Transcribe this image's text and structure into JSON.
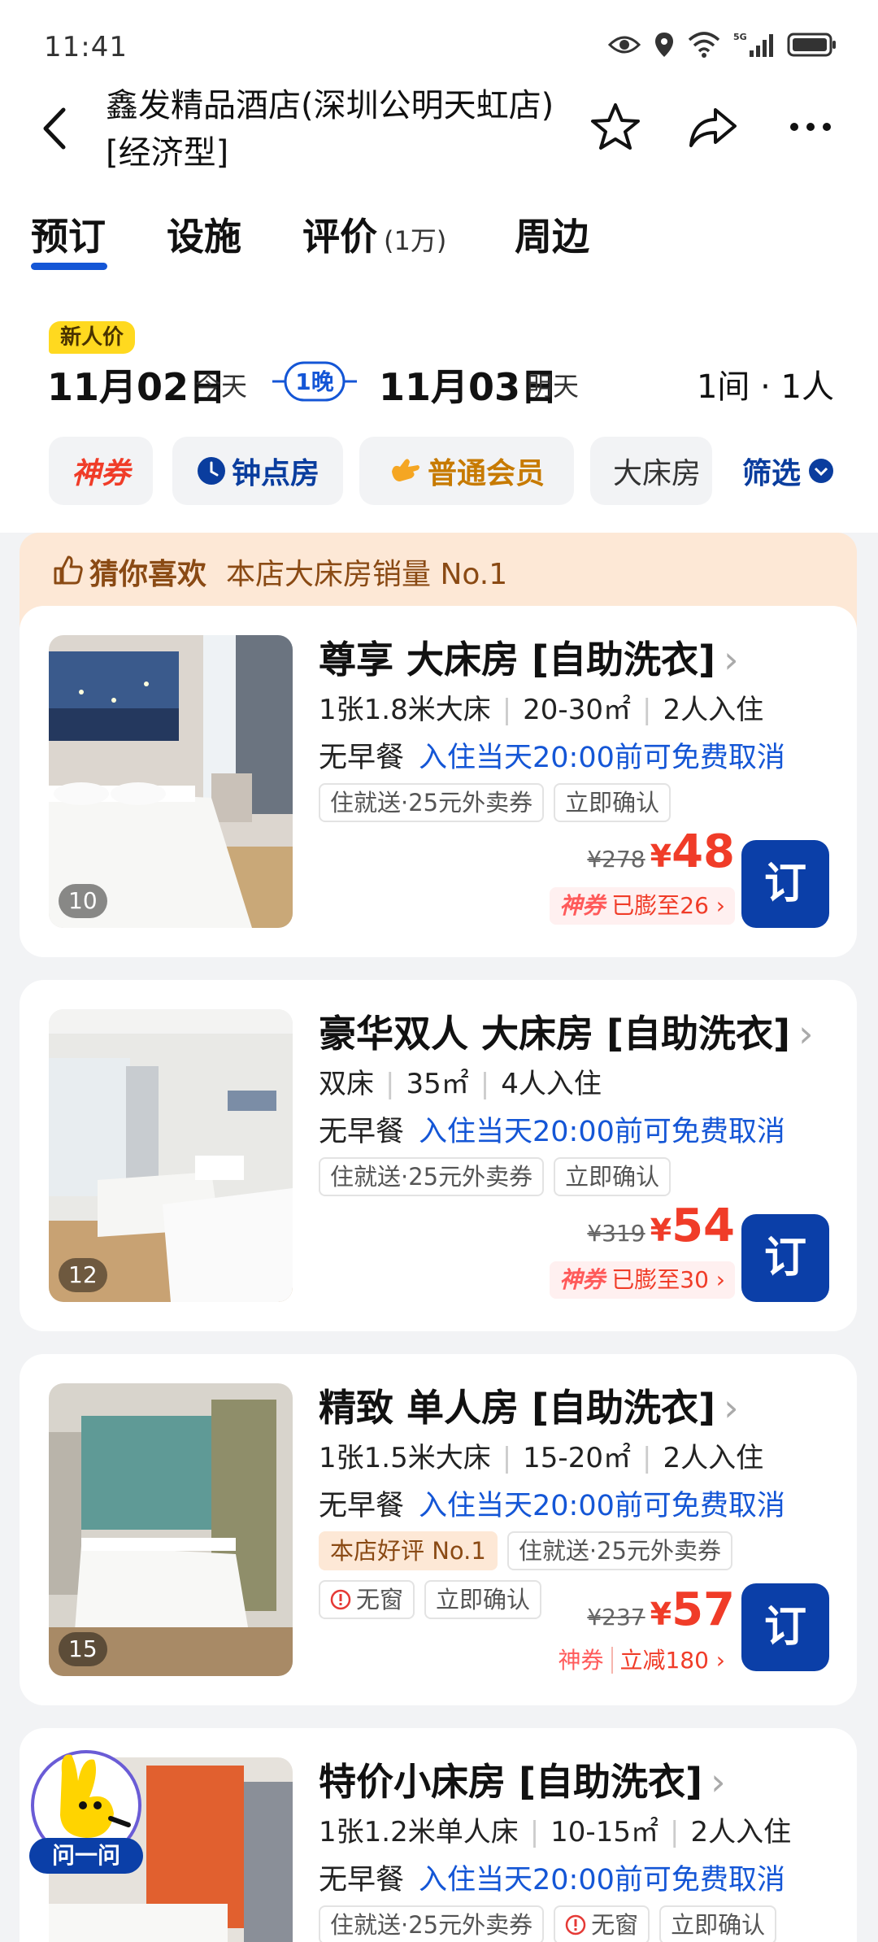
{
  "status": {
    "time": "11:41"
  },
  "header": {
    "title": "鑫发精品酒店(深圳公明天虹店)[经济型]"
  },
  "tabs": [
    {
      "label": "预订"
    },
    {
      "label": "设施"
    },
    {
      "label": "评价",
      "count": "(1万)"
    },
    {
      "label": "周边"
    }
  ],
  "dates": {
    "badge": "新人价",
    "checkin": "11月02日",
    "checkin_sub": "今天",
    "nights": "1晚",
    "checkout": "11月03日",
    "checkout_sub": "明天",
    "rooms": "1间 · 1人"
  },
  "filters": {
    "chips": [
      "神券",
      "钟点房",
      "普通会员",
      "大床房"
    ],
    "filter_label": "筛选"
  },
  "guess": {
    "title": "猜你喜欢",
    "text": "本店大床房销量 No.1"
  },
  "rooms": [
    {
      "name": "尊享 大床房 [自助洗衣]",
      "specs": [
        "1张1.8米大床",
        "20-30㎡",
        "2人入住"
      ],
      "meal": "无早餐",
      "cancel": "入住当天20:00前可免费取消",
      "tags": [
        "住就送·25元外卖券",
        "立即确认"
      ],
      "photo_count": "10",
      "old_price": "¥278",
      "yen": "¥",
      "price": "48",
      "promo_label": "神券",
      "promo": "已膨至26 ›",
      "book": "订"
    },
    {
      "name": "豪华双人 大床房 [自助洗衣]",
      "specs": [
        "双床",
        "35㎡",
        "4人入住"
      ],
      "meal": "无早餐",
      "cancel": "入住当天20:00前可免费取消",
      "tags": [
        "住就送·25元外卖券",
        "立即确认"
      ],
      "photo_count": "12",
      "old_price": "¥319",
      "yen": "¥",
      "price": "54",
      "promo_label": "神券",
      "promo": "已膨至30 ›",
      "book": "订"
    },
    {
      "name": "精致 单人房 [自助洗衣]",
      "specs": [
        "1张1.5米大床",
        "15-20㎡",
        "2人入住"
      ],
      "meal": "无早餐",
      "cancel": "入住当天20:00前可免费取消",
      "tags": [
        "本店好评 No.1",
        "住就送·25元外卖券"
      ],
      "tags2": [
        "无窗",
        "立即确认"
      ],
      "photo_count": "15",
      "old_price": "¥237",
      "yen": "¥",
      "price": "57",
      "promo_label": "神券",
      "promo": "立减180 ›",
      "book": "订"
    },
    {
      "name": "特价小床房 [自助洗衣]",
      "specs": [
        "1张1.2米单人床",
        "10-15㎡",
        "2人入住"
      ],
      "meal": "无早餐",
      "cancel": "入住当天20:00前可免费取消",
      "tags": [
        "住就送·25元外卖券",
        "无窗",
        "立即确认"
      ]
    }
  ],
  "assistant": {
    "label": "问一问"
  },
  "colors": {
    "brand_blue": "#0b3fa8",
    "price_red": "#f03c28",
    "link_blue": "#1456d6",
    "guess_bg": "#fde8d6"
  }
}
